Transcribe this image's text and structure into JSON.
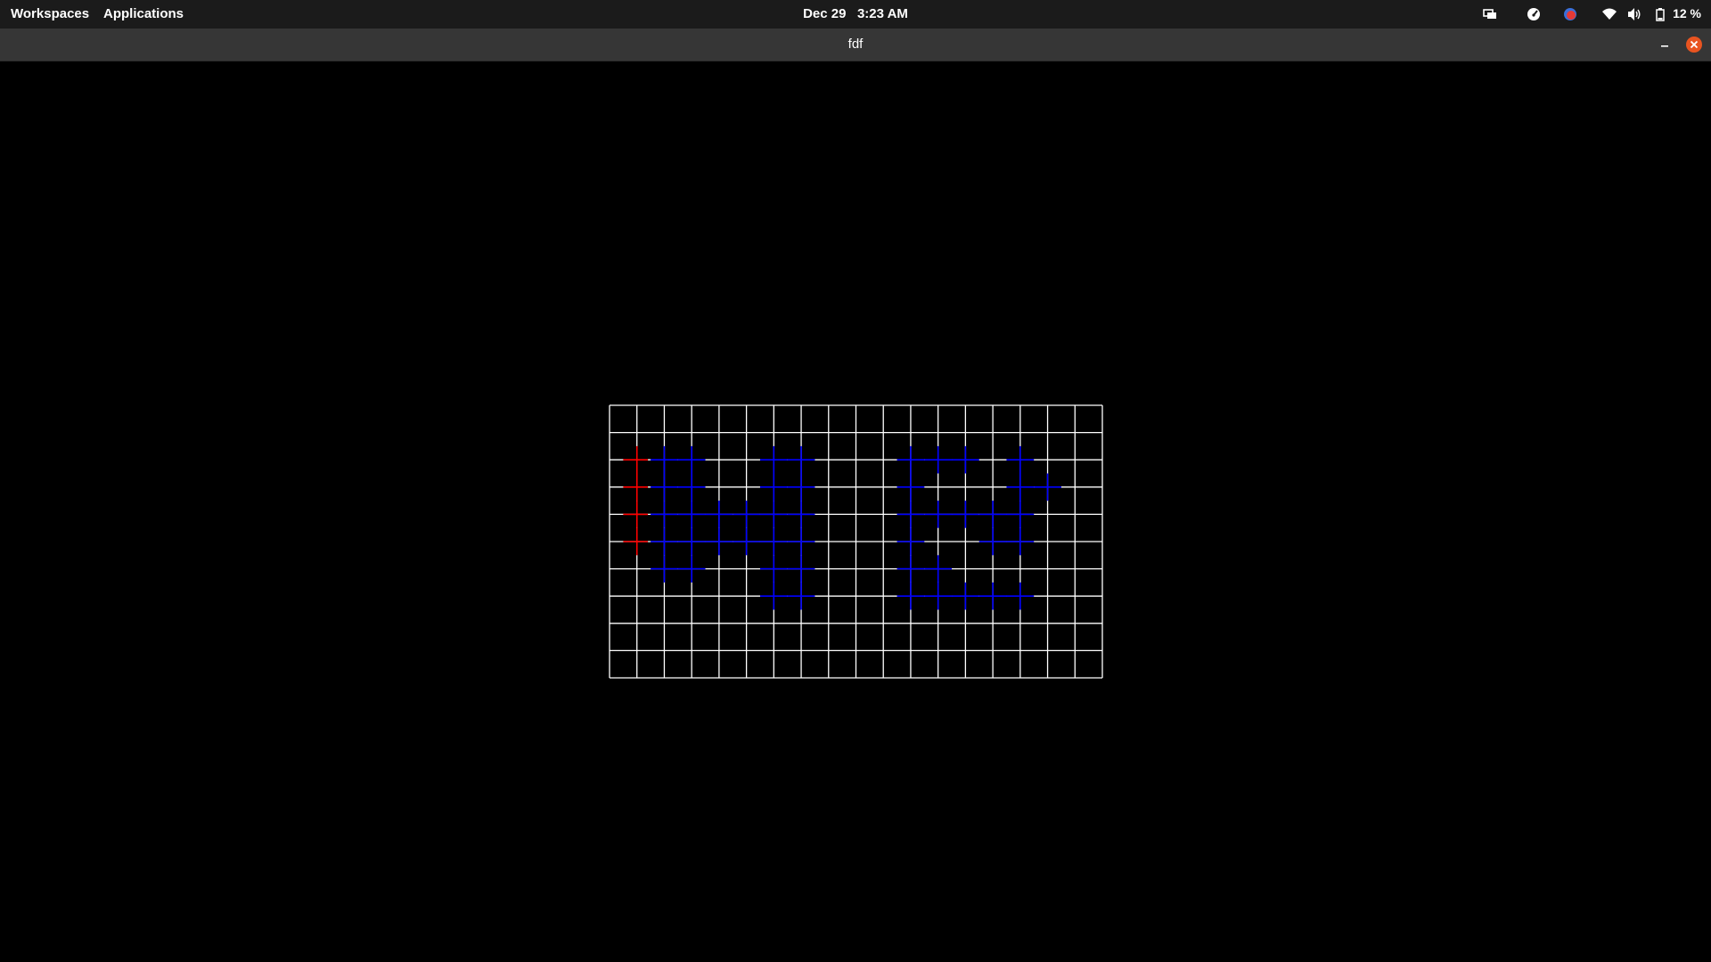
{
  "topbar": {
    "workspaces_label": "Workspaces",
    "applications_label": "Applications",
    "date": "Dec 29",
    "time": "3:23 AM",
    "tray_icons": [
      "screen-icon",
      "speedometer-icon",
      "recorder-icon",
      "wifi-icon",
      "volume-icon",
      "battery-icon"
    ],
    "battery_percent": "12 %"
  },
  "window": {
    "title": "fdf",
    "close_color": "#e95420"
  },
  "wireframe": {
    "grid_columns": 18,
    "grid_rows": 10,
    "grid_color": "#ffffff",
    "background": "#000000",
    "highlight_colors": {
      "low": "#ff0000",
      "high": "#0000ff"
    }
  }
}
